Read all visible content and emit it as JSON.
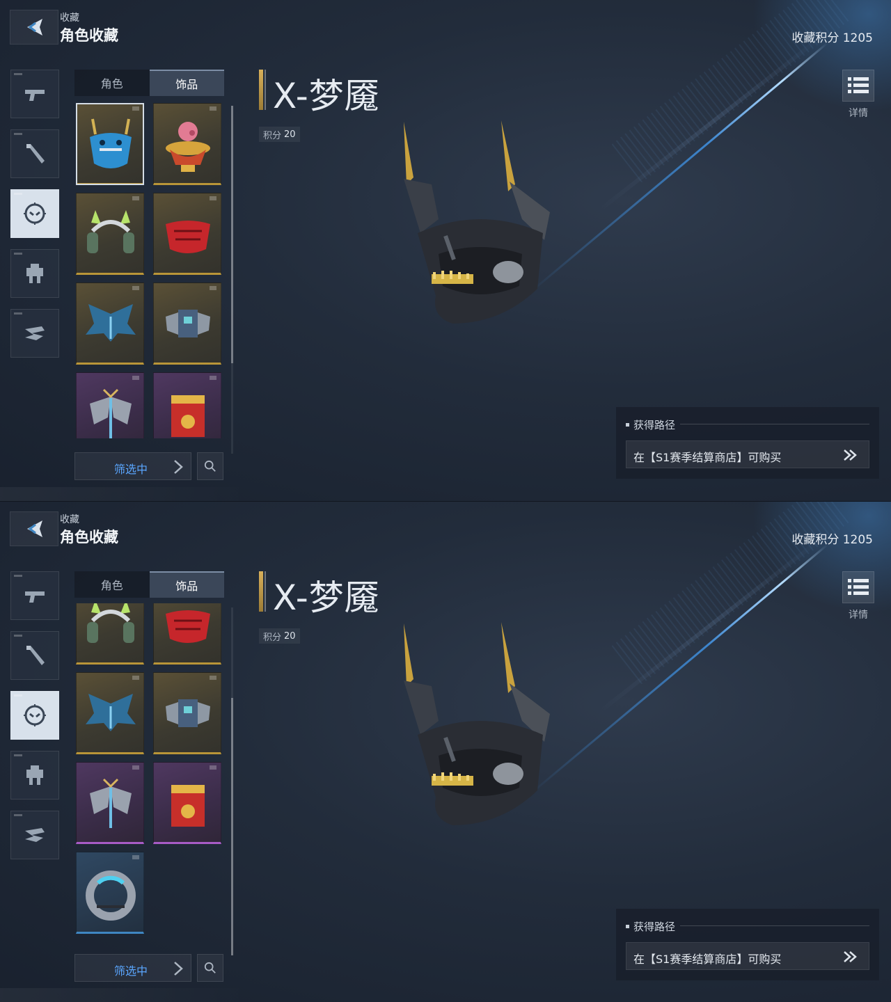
{
  "header": {
    "breadcrumb_parent": "收藏",
    "breadcrumb_title": "角色收藏",
    "collection_score_label": "收藏积分 1205",
    "detail_label": "详情"
  },
  "rail": {
    "items": [
      {
        "name": "pistol-icon",
        "active": false
      },
      {
        "name": "melee-weapon-icon",
        "active": false
      },
      {
        "name": "character-mask-icon",
        "active": true
      },
      {
        "name": "mech-icon",
        "active": false
      },
      {
        "name": "aircraft-icon",
        "active": false
      }
    ]
  },
  "tabs": [
    {
      "label": "角色",
      "active": false
    },
    {
      "label": "饰品",
      "active": true
    }
  ],
  "filter": {
    "label": "筛选中"
  },
  "item": {
    "name": "X-梦魇",
    "points_label": "积分",
    "points_value": "20"
  },
  "acquisition": {
    "header": "获得路径",
    "route_text": "在【S1赛季结算商店】可购买"
  },
  "colors": {
    "accent_blue": "#5aa6ff",
    "gold_rarity": "#b99538",
    "purple_rarity": "#a85cc6",
    "blue_rarity": "#3f86c2"
  },
  "screen1": {
    "cards": [
      {
        "icon": "blue-mask-icon",
        "rarity": "gold",
        "selected": true
      },
      {
        "icon": "pig-bowl-icon",
        "rarity": "gold",
        "selected": false
      },
      {
        "icon": "cat-ear-headphones-icon",
        "rarity": "gold",
        "selected": false
      },
      {
        "icon": "red-mask-icon",
        "rarity": "gold",
        "selected": false
      },
      {
        "icon": "ice-wings-icon",
        "rarity": "gold",
        "selected": false
      },
      {
        "icon": "mech-backpack-icon",
        "rarity": "gold",
        "selected": false
      },
      {
        "icon": "armor-wings-icon",
        "rarity": "purple",
        "selected": false
      },
      {
        "icon": "red-chest-icon",
        "rarity": "purple",
        "selected": false
      }
    ]
  },
  "screen2": {
    "cards": [
      {
        "icon": "cat-ear-headphones-icon",
        "rarity": "gold",
        "selected": false
      },
      {
        "icon": "red-mask-icon",
        "rarity": "gold",
        "selected": false
      },
      {
        "icon": "ice-wings-icon",
        "rarity": "gold",
        "selected": false
      },
      {
        "icon": "mech-backpack-icon",
        "rarity": "gold",
        "selected": false
      },
      {
        "icon": "armor-wings-icon",
        "rarity": "purple",
        "selected": false
      },
      {
        "icon": "red-chest-icon",
        "rarity": "purple",
        "selected": false
      },
      {
        "icon": "tech-ring-icon",
        "rarity": "blue",
        "selected": false
      }
    ]
  }
}
